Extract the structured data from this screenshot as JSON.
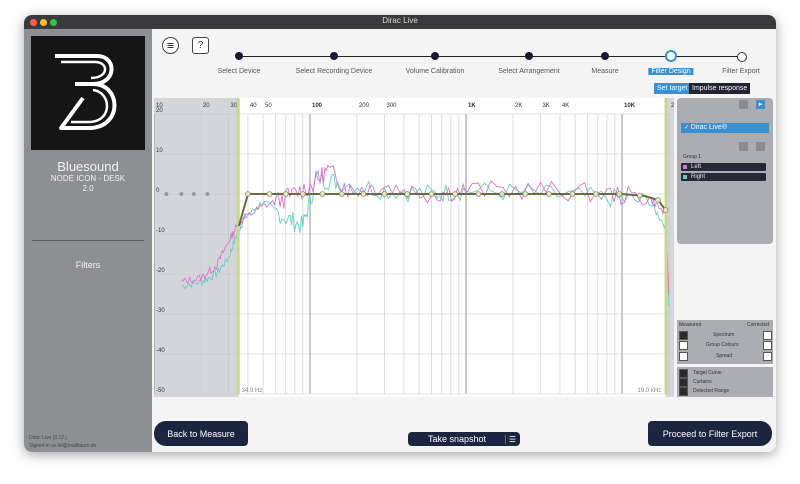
{
  "window": {
    "title": "Dirac Live"
  },
  "sidebar": {
    "brand": "Bluesound",
    "model": "NODE ICON - DESK",
    "version_num": "2.0",
    "filters_label": "Filters",
    "app_version": "Dirac Live (3.12.)",
    "signed_in": "Signed in as lkl@mailbaum.de"
  },
  "toolbar": {
    "help_label": "?"
  },
  "steps": [
    {
      "label": "Select Device"
    },
    {
      "label": "Select Recording Device"
    },
    {
      "label": "Volume Calibration"
    },
    {
      "label": "Select Arrangement"
    },
    {
      "label": "Measure"
    },
    {
      "label": "Filter Design",
      "active": true
    },
    {
      "label": "Filter Export"
    }
  ],
  "chart_tabs": {
    "set_target": "Set target",
    "impulse": "Impulse response"
  },
  "chart_data": {
    "type": "line",
    "x_ticks": [
      "10",
      "20",
      "30",
      "40",
      "50",
      "100",
      "200",
      "300",
      "1K",
      "2K",
      "3K",
      "4K",
      "10K",
      "20K"
    ],
    "y_ticks": [
      "20",
      "10",
      "0",
      "-10",
      "-20",
      "-30",
      "-40",
      "-50"
    ],
    "ylim": [
      -50,
      20
    ],
    "lower_limit_label": "34.9 Hz",
    "upper_limit_label": "19.0 kHz",
    "series": [
      {
        "name": "Target Curve",
        "color": "#6a6a45",
        "x": [
          35,
          40,
          60,
          80,
          100,
          200,
          1000,
          5000,
          10000,
          14000,
          17000,
          19000
        ],
        "y": [
          -8,
          0,
          0,
          0,
          0,
          0,
          0,
          0,
          0,
          -0.5,
          -1.5,
          -4
        ]
      },
      {
        "name": "Left",
        "color": "#d878c8",
        "x": [
          15,
          20,
          25,
          30,
          34,
          38,
          50,
          70,
          100,
          130,
          180,
          300,
          600,
          1000,
          3000,
          8000,
          15000,
          19000,
          20000
        ],
        "y": [
          -22,
          -21,
          -18,
          -12,
          -8,
          -6,
          -3,
          -1,
          2,
          6,
          1,
          2,
          0,
          1,
          1,
          0,
          -1,
          -5,
          -25
        ]
      },
      {
        "name": "Right",
        "color": "#6cccc0",
        "x": [
          15,
          20,
          25,
          30,
          34,
          38,
          50,
          70,
          90,
          110,
          150,
          300,
          600,
          1000,
          3000,
          8000,
          15000,
          19000,
          20000
        ],
        "y": [
          -23,
          -22,
          -20,
          -16,
          -10,
          -6,
          -2,
          -6,
          -8,
          4,
          3,
          1,
          0,
          1,
          0,
          -1,
          -2,
          -8,
          -28
        ]
      }
    ]
  },
  "right_panel": {
    "selected": "Dirac Live®",
    "group": "Group 1",
    "channels": [
      {
        "name": "Left",
        "color": "#d878c8"
      },
      {
        "name": "Right",
        "color": "#6cccc0"
      }
    ]
  },
  "options": {
    "measured": "Measured",
    "corrected": "Corrected",
    "spectrum": "Spectrum",
    "group_colours": "Group Colours",
    "spread": "Spread"
  },
  "display": {
    "target_curve": "Target Curve",
    "curtains": "Curtains",
    "detected_range": "Detected Range"
  },
  "buttons": {
    "back": "Back to Measure",
    "snapshot": "Take snapshot",
    "proceed": "Proceed to Filter Export"
  },
  "colors": {
    "accent": "#3a8fd0",
    "dark_button": "#1b2540",
    "curtain": "#c8d78f"
  }
}
